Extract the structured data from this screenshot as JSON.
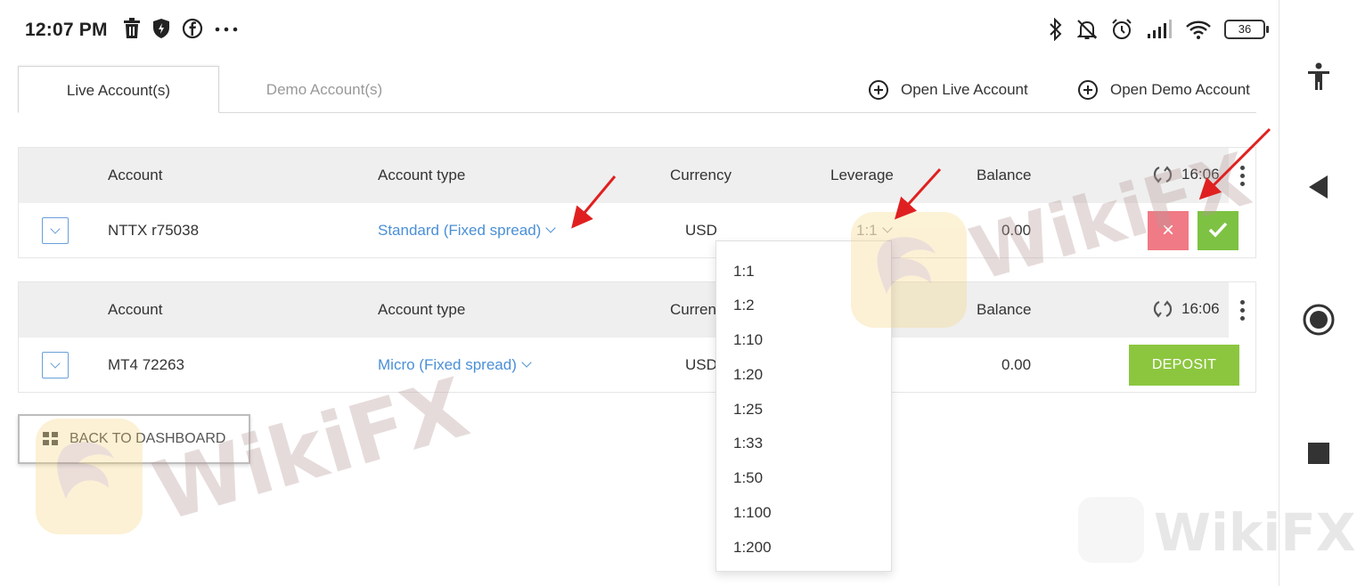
{
  "status_bar": {
    "time": "12:07 PM",
    "left_icons": [
      "trash-icon",
      "shield-icon",
      "facebook-icon",
      "more-dots-icon"
    ],
    "right_icons": [
      "bluetooth-icon",
      "muted-bell-icon",
      "alarm-icon",
      "signal-icon",
      "wifi-icon"
    ],
    "battery": "36"
  },
  "tabs": {
    "live": "Live Account(s)",
    "demo": "Demo Account(s)"
  },
  "actions": {
    "open_live": "Open Live Account",
    "open_demo": "Open Demo Account"
  },
  "table_headers": {
    "account": "Account",
    "account_type": "Account type",
    "currency": "Currency",
    "currency_truncated": "Curren",
    "leverage": "Leverage",
    "balance": "Balance"
  },
  "accounts": [
    {
      "account": "NTTX r75038",
      "account_type": "Standard (Fixed spread)",
      "currency": "USD",
      "leverage": "1:1",
      "balance": "0.00",
      "sync_time": "16:06"
    },
    {
      "account": "MT4 72263",
      "account_type": "Micro (Fixed spread)",
      "currency": "USD",
      "balance": "0.00",
      "sync_time": "16:06",
      "deposit_label": "DEPOSIT"
    }
  ],
  "edit_buttons": {
    "cancel": "×"
  },
  "leverage_options": [
    "1:1",
    "1:2",
    "1:10",
    "1:20",
    "1:25",
    "1:33",
    "1:50",
    "1:100",
    "1:200"
  ],
  "back_button": "BACK TO DASHBOARD",
  "watermark": "WikiFX",
  "colors": {
    "link_blue": "#4a8fd6",
    "cancel_red": "#f07a85",
    "confirm_green": "#7dc242",
    "deposit_green": "#8cc63f",
    "header_grey": "#efefef",
    "annotation_red": "#e02020"
  }
}
